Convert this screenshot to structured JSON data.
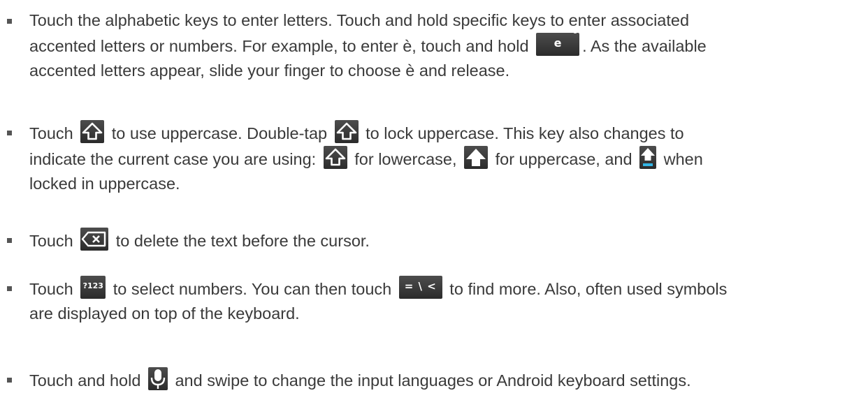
{
  "keys": {
    "e": "e",
    "e_superscript": "3",
    "numbers": "?123",
    "symbols": "= \\ <"
  },
  "icons": {
    "shift": "shift-arrow-outline-icon",
    "shift_filled": "shift-arrow-filled-icon",
    "shift_locked": "shift-arrow-locked-icon",
    "delete": "backspace-delete-icon",
    "mic": "microphone-icon"
  },
  "items": [
    {
      "t1": "Touch the alphabetic keys to enter letters. Touch and hold specific keys to enter associated",
      "t2": "accented letters or numbers. For example, to enter è, touch and hold ",
      "t3": ". As the available",
      "t4": "accented letters appear, slide your finger to choose è and release."
    },
    {
      "t1": "Touch ",
      "t2": " to use uppercase. Double-tap ",
      "t3": " to lock uppercase. This key also changes to",
      "t4": "indicate the current case you are using: ",
      "t5": " for lowercase, ",
      "t6": " for uppercase, and ",
      "t7": " when",
      "t8": "locked in uppercase."
    },
    {
      "t1": "Touch ",
      "t2": " to delete the text before the cursor."
    },
    {
      "t1": "Touch ",
      "t2": " to select numbers. You can then touch ",
      "t3": " to find more. Also, often used symbols",
      "t4": "are displayed on top of the keyboard."
    },
    {
      "t1": "Touch and hold ",
      "t2": " and swipe to change the input languages or Android keyboard settings."
    }
  ]
}
